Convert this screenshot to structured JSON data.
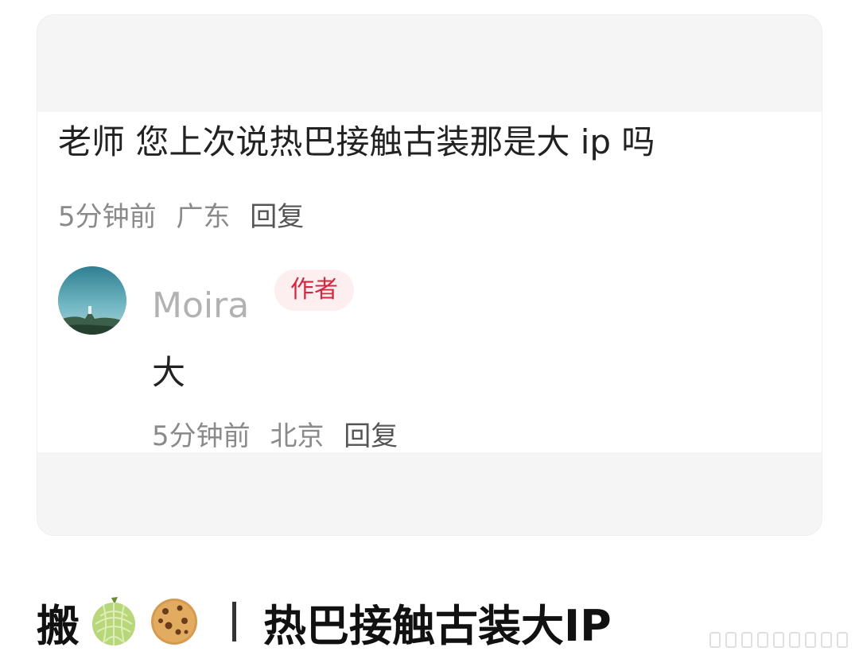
{
  "comment": {
    "text": "老师 您上次说热巴接触古装那是大 ip 吗",
    "time": "5分钟前",
    "location": "广东",
    "reply_label": "回复"
  },
  "author_reply": {
    "avatar_icon": "landscape-avatar-icon",
    "username": "Moira",
    "badge": "作者",
    "text": "大",
    "time": "5分钟前",
    "location": "北京",
    "reply_label": "回复"
  },
  "caption": {
    "prefix": "搬",
    "icons": [
      "melon-emoji-icon",
      "cookie-emoji-icon"
    ],
    "separator": "|",
    "title": "热巴接触古装大IP"
  },
  "colors": {
    "card_bg": "#f5f5f5",
    "badge_bg": "#fdeef0",
    "badge_text": "#d3283e",
    "meta_text": "#8a8a8a",
    "username_text": "#b2b2b2"
  }
}
